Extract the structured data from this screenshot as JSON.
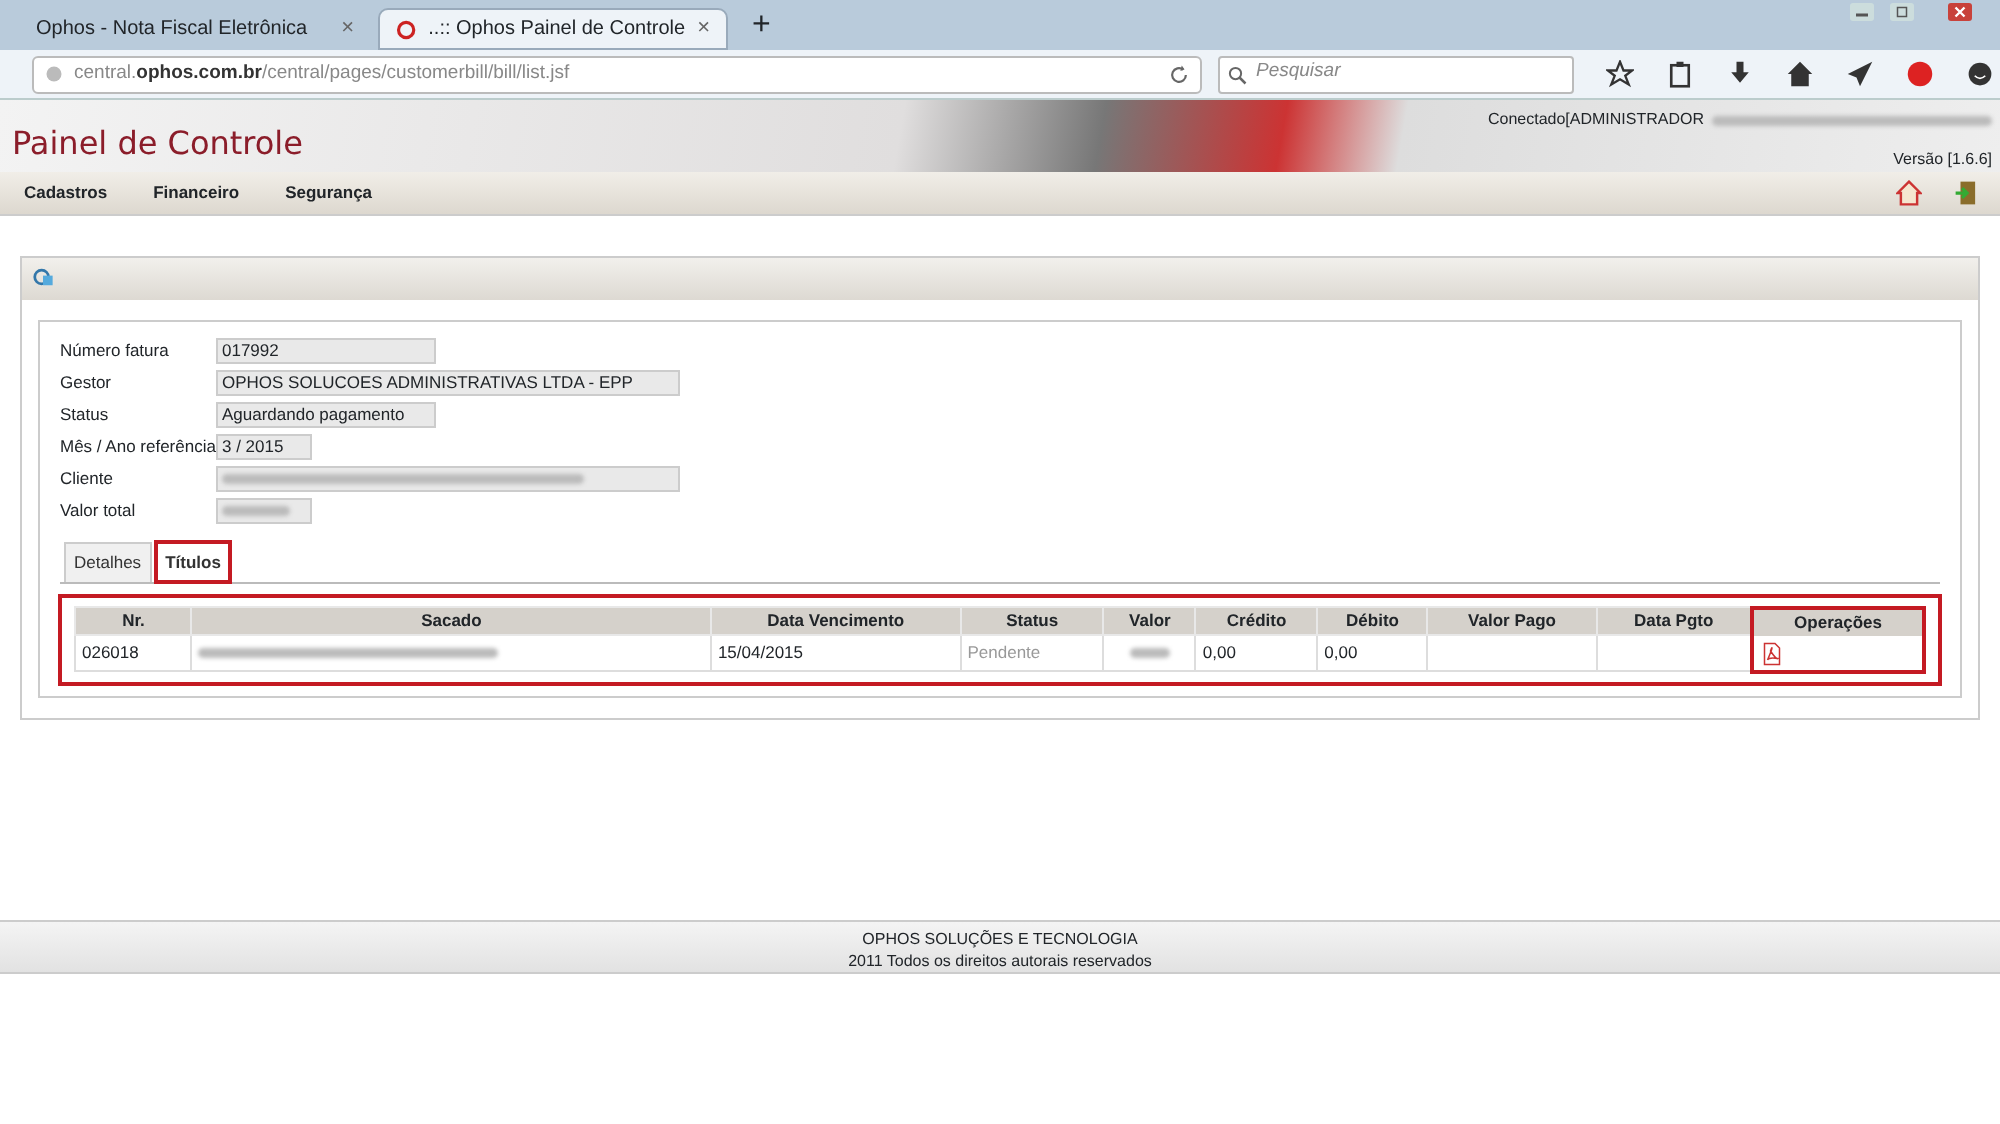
{
  "browser": {
    "tabs": [
      {
        "title": "Ophos - Nota Fiscal Eletrônica",
        "selected": false,
        "close": "×"
      },
      {
        "title": "..:: Ophos Painel de Controle",
        "selected": true,
        "close": "×"
      }
    ],
    "new_tab": "+",
    "url": "central.**ophos.com.br**/central/pages/customerbill/bill/list.jsf",
    "search": {
      "placeholder": "Pesquisar"
    }
  },
  "header": {
    "title": "Painel de Controle",
    "connected": "Conectado[ADMINISTRADOR",
    "version": "Versão [1.6.6]"
  },
  "menu": [
    "Cadastros",
    "Financeiro",
    "Segurança"
  ],
  "form": [
    {
      "label": "Número fatura",
      "value": "017992",
      "blurred": false
    },
    {
      "label": "Gestor",
      "value": "OPHOS SOLUCOES ADMINISTRATIVAS LTDA - EPP",
      "blurred": false
    },
    {
      "label": "Status",
      "value": "Aguardando pagamento",
      "blurred": false
    },
    {
      "label": "Mês / Ano referência",
      "value": "3 / 2015",
      "blurred": false
    },
    {
      "label": "Cliente",
      "blurred": true
    },
    {
      "label": "Valor total",
      "blurred": true
    }
  ],
  "detail_tabs": [
    {
      "label": "Detalhes",
      "selected": false,
      "highlighted": false
    },
    {
      "label": "Títulos",
      "selected": true,
      "highlighted": true
    }
  ],
  "table": {
    "highlighted": true,
    "columns": [
      {
        "label": "Nr.",
        "highlighted": false
      },
      {
        "label": "Sacado",
        "highlighted": false
      },
      {
        "label": "Data Vencimento",
        "highlighted": false
      },
      {
        "label": "Status",
        "highlighted": false
      },
      {
        "label": "Valor",
        "highlighted": false
      },
      {
        "label": "Crédito",
        "highlighted": false
      },
      {
        "label": "Débito",
        "highlighted": false
      },
      {
        "label": "Valor Pago",
        "highlighted": false
      },
      {
        "label": "Data Pgto",
        "highlighted": false
      },
      {
        "label": "Operações",
        "highlighted": true
      }
    ],
    "rows": [
      [
        {
          "kind": "text",
          "text": "026018"
        },
        {
          "kind": "blur"
        },
        {
          "kind": "text",
          "text": "15/04/2015"
        },
        {
          "kind": "muted",
          "text": "Pendente"
        },
        {
          "kind": "blur"
        },
        {
          "kind": "text",
          "text": "0,00"
        },
        {
          "kind": "text",
          "text": "0,00"
        },
        {
          "kind": "empty"
        },
        {
          "kind": "empty"
        },
        {
          "kind": "pdf"
        }
      ]
    ]
  },
  "footer": [
    "OPHOS SOLUÇÕES E TECNOLOGIA",
    "2011 Todos os direitos autorais reservados"
  ]
}
